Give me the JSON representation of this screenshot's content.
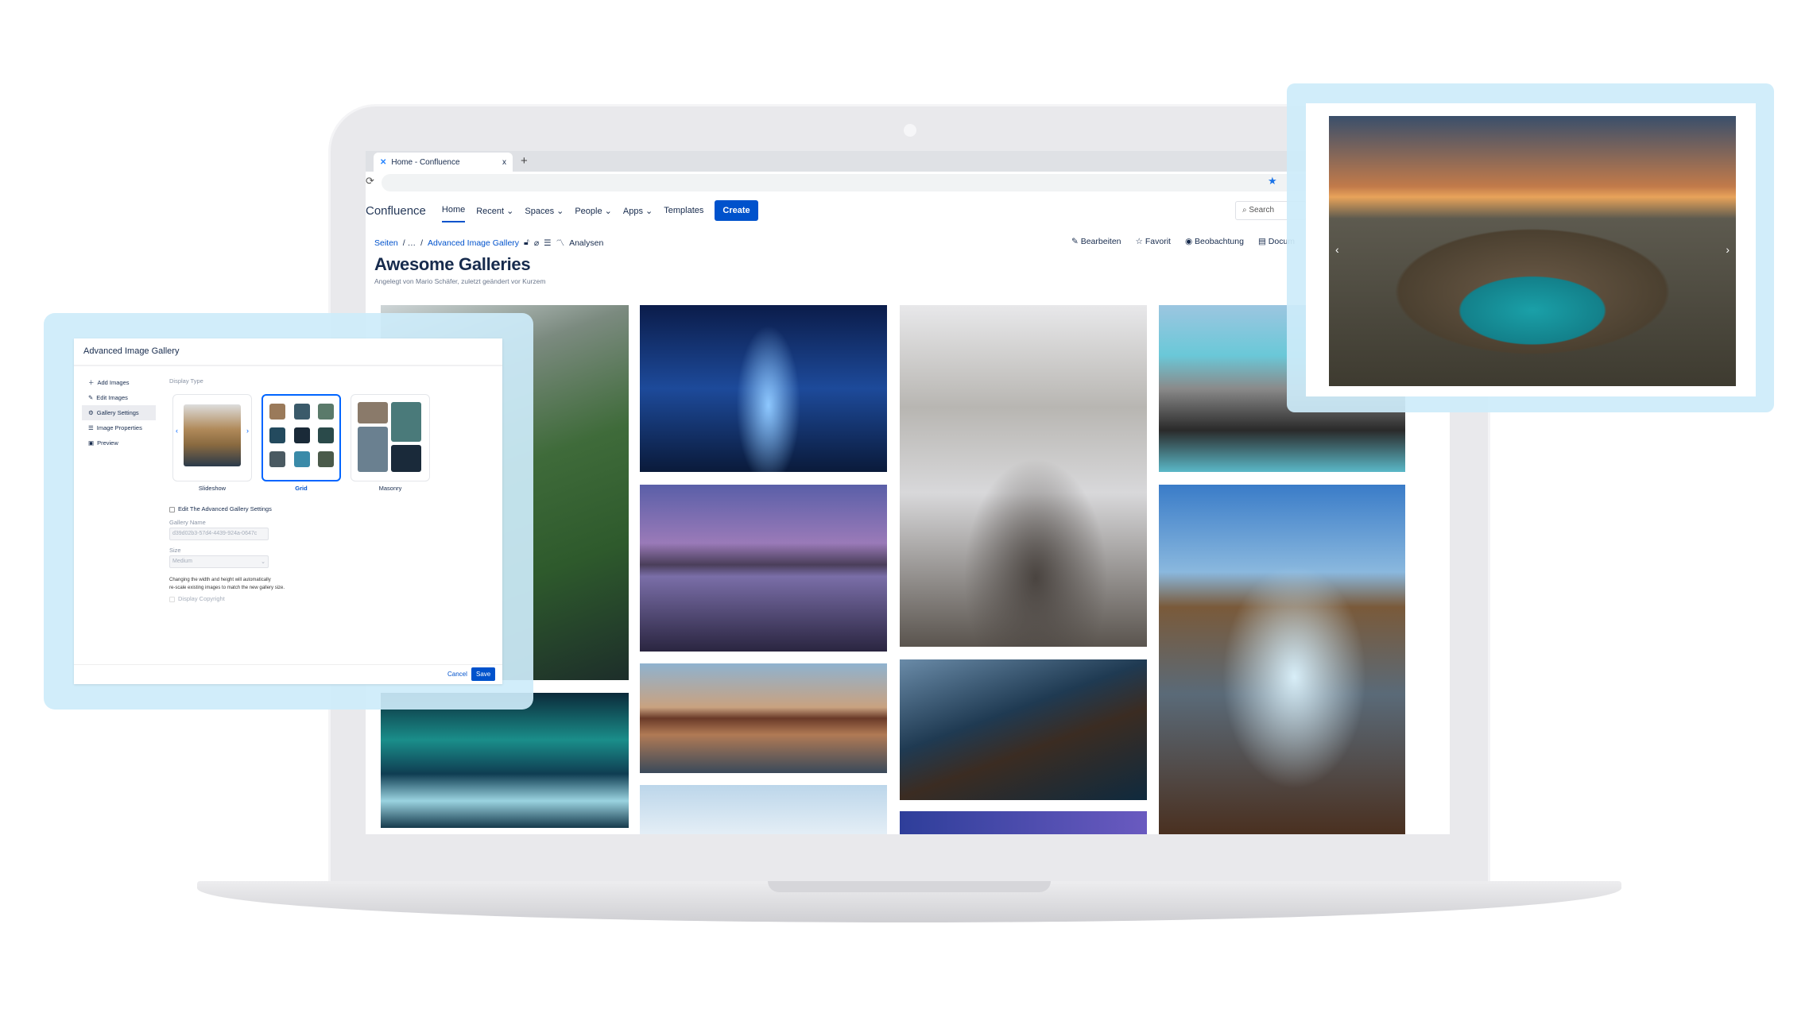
{
  "browser": {
    "tab_title": "Home - Confluence",
    "tab_close": "x",
    "new_tab": "+"
  },
  "nav": {
    "logo": "Confluence",
    "items": [
      "Home",
      "Recent ⌄",
      "Spaces ⌄",
      "People ⌄",
      "Apps ⌄",
      "Templates"
    ],
    "create": "Create",
    "search_placeholder": "Search"
  },
  "breadcrumb": {
    "root": "Seiten",
    "sep1": "/ …",
    "sep2": "/",
    "page": "Advanced Image Gallery",
    "analytics": "Analysen"
  },
  "page_actions": [
    "Bearbeiten",
    "Favorit",
    "Beobachtung",
    "Docum"
  ],
  "page": {
    "title": "Awesome Galleries",
    "byline": "Angelegt von Mario Schäfer, zuletzt geändert vor Kurzem"
  },
  "dialog": {
    "title": "Advanced Image Gallery",
    "sidebar": [
      "Add Images",
      "Edit Images",
      "Gallery Settings",
      "Image Properties",
      "Preview"
    ],
    "active_sidebar": "Gallery Settings",
    "display_type_label": "Display Type",
    "display_types": [
      "Slideshow",
      "Grid",
      "Masonry"
    ],
    "selected_display_type": "Grid",
    "edit_settings_label": "Edit The Advanced Gallery Settings",
    "gallery_name_label": "Gallery Name",
    "gallery_name_value": "d39d02b3-57d4-4439-924a-0647c",
    "size_label": "Size",
    "size_value": "Medium",
    "hint_line1": "Changing the width and height will automatically",
    "hint_line2": "re-scale existing images to match the new gallery size.",
    "copyright_label": "Display Copyright",
    "cancel": "Cancel",
    "save": "Save"
  },
  "colors": {
    "accent": "#0052cc",
    "highlight_panel": "#cdebfa"
  }
}
